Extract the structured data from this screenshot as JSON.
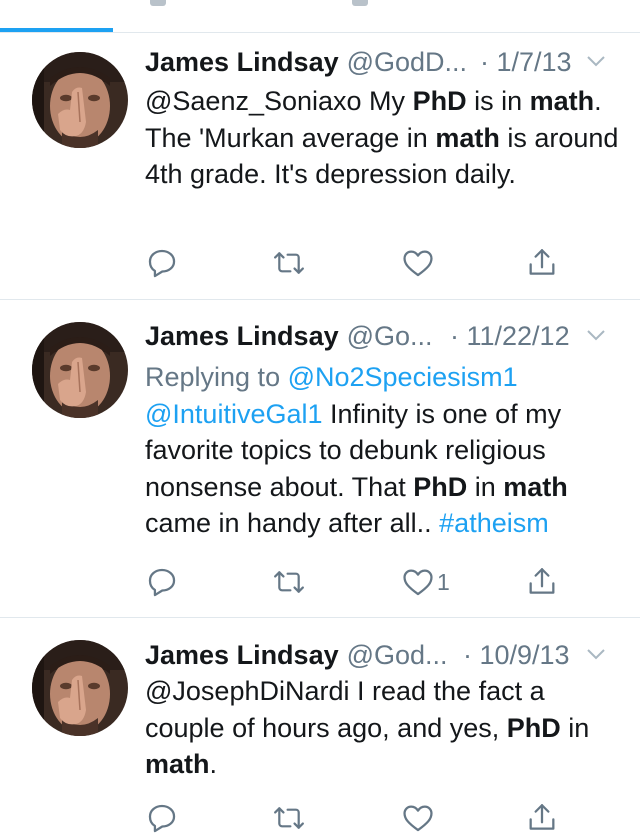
{
  "colors": {
    "accent": "#1da1f2",
    "muted": "#657786",
    "divider": "#e1e8ed",
    "text": "#14171a"
  },
  "tweets": [
    {
      "name": "James Lindsay",
      "handle": "@GodD...",
      "date": "· 1/7/13",
      "text": [
        {
          "t": "@Saenz_Soniaxo My ",
          "s": "n"
        },
        {
          "t": "PhD",
          "s": "b"
        },
        {
          "t": " is in ",
          "s": "n"
        },
        {
          "t": "math",
          "s": "b"
        },
        {
          "t": ". The 'Murkan average in ",
          "s": "n"
        },
        {
          "t": "math",
          "s": "b"
        },
        {
          "t": " is around 4th grade. It's depression daily.",
          "s": "n"
        }
      ],
      "like_count": ""
    },
    {
      "name": "James Lindsay",
      "handle": "@Go...",
      "date": "· 11/22/12",
      "reply_prefix": "Replying to ",
      "reply_to": "@No2Speciesism1",
      "text": [
        {
          "t": "@IntuitiveGal1",
          "s": "l"
        },
        {
          "t": " Infinity is one of my favorite topics to debunk religious nonsense about. That ",
          "s": "n"
        },
        {
          "t": "PhD",
          "s": "b"
        },
        {
          "t": " in ",
          "s": "n"
        },
        {
          "t": "math",
          "s": "b"
        },
        {
          "t": " came in handy after all.. ",
          "s": "n"
        },
        {
          "t": "#atheism",
          "s": "l"
        }
      ],
      "like_count": "1"
    },
    {
      "name": "James Lindsay",
      "handle": "@God...",
      "date": "· 10/9/13",
      "text": [
        {
          "t": "@JosephDiNardi I read the fact a couple of hours ago, and yes, ",
          "s": "n"
        },
        {
          "t": "PhD",
          "s": "b"
        },
        {
          "t": " in ",
          "s": "n"
        },
        {
          "t": "math",
          "s": "b"
        },
        {
          "t": ".",
          "s": "n"
        }
      ],
      "like_count": ""
    }
  ]
}
